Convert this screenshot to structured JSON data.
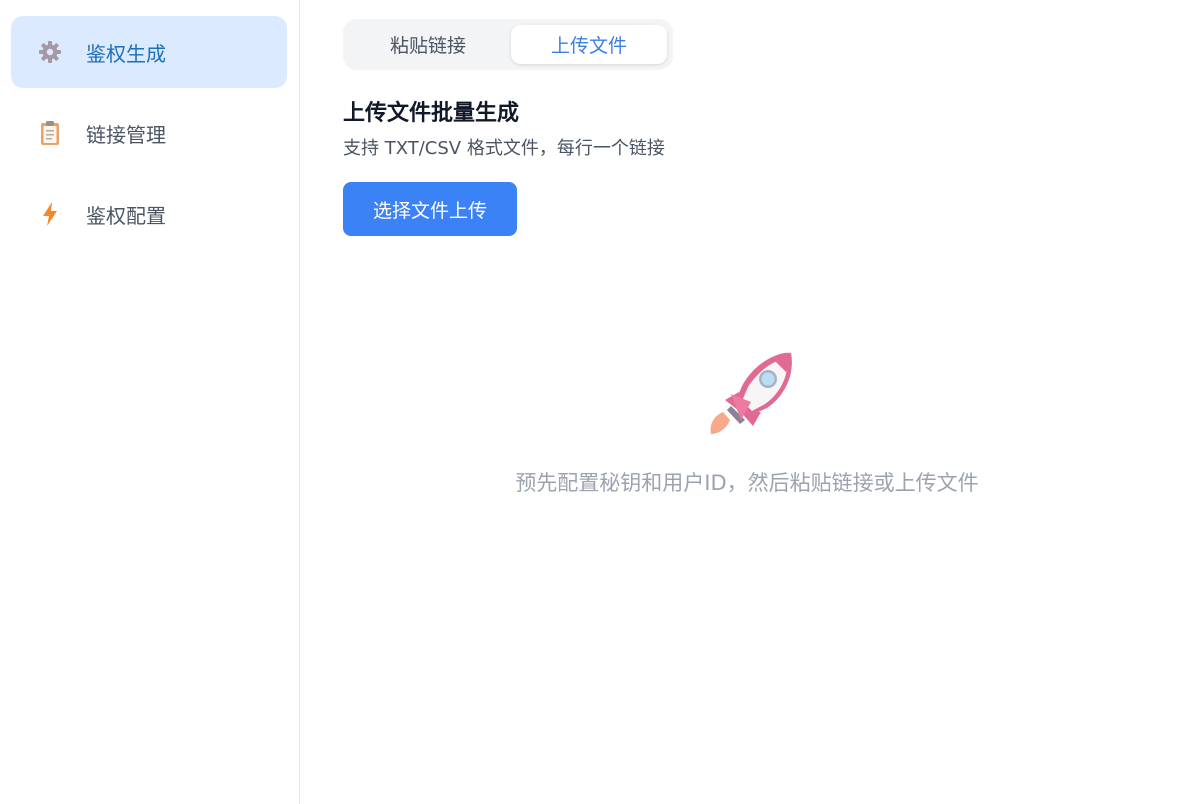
{
  "sidebar": {
    "items": [
      {
        "label": "鉴权生成",
        "icon": "gear-icon",
        "active": true
      },
      {
        "label": "链接管理",
        "icon": "clipboard-icon",
        "active": false
      },
      {
        "label": "鉴权配置",
        "icon": "lightning-icon",
        "active": false
      }
    ]
  },
  "tabs": {
    "paste_label": "粘贴链接",
    "upload_label": "上传文件",
    "selected": "上传文件"
  },
  "upload": {
    "title": "上传文件批量生成",
    "subtitle": "支持 TXT/CSV 格式文件，每行一个链接",
    "button_label": "选择文件上传"
  },
  "empty_state": {
    "icon": "rocket-icon",
    "message": "预先配置秘钥和用户ID，然后粘贴链接或上传文件"
  },
  "colors": {
    "accent": "#3b82f6",
    "active_nav_bg": "#dbeafe",
    "active_nav_text": "#1d6fb8"
  }
}
